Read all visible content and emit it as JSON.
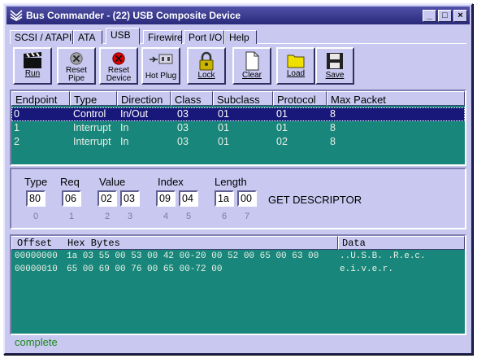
{
  "window": {
    "title": "Bus Commander - (22) USB Composite Device",
    "controls": [
      "_",
      "□",
      "×"
    ]
  },
  "tabs": [
    "SCSI / ATAPI",
    "ATA",
    "USB",
    "Firewire",
    "Port I/O",
    "Help"
  ],
  "active_tab": "USB",
  "toolbar": {
    "run": "Run",
    "reset_pipe": "Reset\nPipe",
    "reset_device": "Reset\nDevice",
    "hot_plug": "Hot Plug",
    "lock": "Lock",
    "clear": "Clear",
    "load": "Load",
    "save": "Save"
  },
  "endpoints": {
    "columns": [
      "Endpoint",
      "Type",
      "Direction",
      "Class",
      "Subclass",
      "Protocol",
      "Max Packet"
    ],
    "rows": [
      {
        "endpoint": "0",
        "type": "Control",
        "direction": "In/Out",
        "class": "03",
        "subclass": "01",
        "protocol": "01",
        "max_packet": "8",
        "selected": true
      },
      {
        "endpoint": "1",
        "type": "Interrupt",
        "direction": "In",
        "class": "03",
        "subclass": "01",
        "protocol": "01",
        "max_packet": "8",
        "selected": false
      },
      {
        "endpoint": "2",
        "type": "Interrupt",
        "direction": "In",
        "class": "03",
        "subclass": "01",
        "protocol": "02",
        "max_packet": "8",
        "selected": false
      }
    ]
  },
  "setup": {
    "labels": {
      "type": "Type",
      "req": "Req",
      "value": "Value",
      "index": "Index",
      "length": "Length"
    },
    "bytes": [
      "80",
      "06",
      "02",
      "03",
      "09",
      "04",
      "1a",
      "00"
    ],
    "byte_indices": [
      "0",
      "1",
      "2",
      "3",
      "4",
      "5",
      "6",
      "7"
    ],
    "description": "GET DESCRIPTOR"
  },
  "hexdump": {
    "headers": {
      "offset": "Offset",
      "hex": "Hex Bytes",
      "data": "Data"
    },
    "lines": [
      {
        "offset": "00000000",
        "hex": "1a 03 55 00 53 00 42 00-20 00 52 00 65 00 63 00",
        "ascii": "..U.S.B. .R.e.c."
      },
      {
        "offset": "00000010",
        "hex": "65 00 69 00 76 00 65 00-72 00",
        "ascii": "e.i.v.e.r."
      }
    ]
  },
  "status": "complete",
  "colors": {
    "grid_bg": "#18867a",
    "selection": "#18187a",
    "window_bg": "#c8c8f0",
    "status_text": "#1c8a1c"
  }
}
